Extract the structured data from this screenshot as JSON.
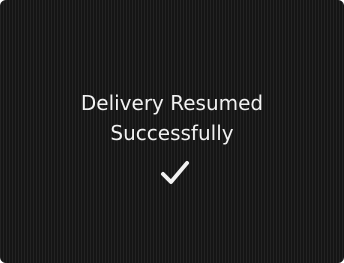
{
  "screen": {
    "message": {
      "line1": "Delivery Resumed",
      "line2": "Successfully"
    },
    "status_icon": "checkmark-icon",
    "colors": {
      "background": "#1c1c1c",
      "text": "#f2f2f2"
    }
  }
}
